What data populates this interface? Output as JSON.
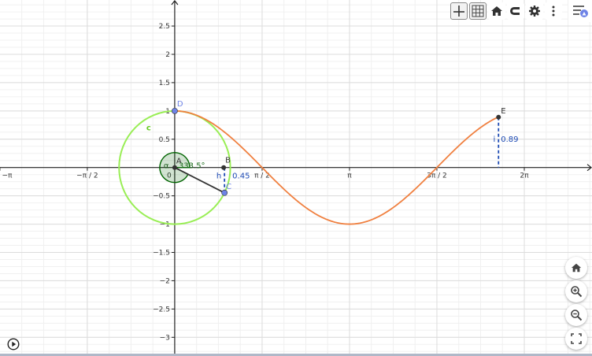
{
  "axes": {
    "x_ticks": [
      {
        "label": "−π",
        "value": -3.14159
      },
      {
        "label": "−π / 2",
        "value": -1.5708
      },
      {
        "label": "0",
        "value": 0
      },
      {
        "label": "π / 2",
        "value": 1.5708
      },
      {
        "label": "π",
        "value": 3.14159
      },
      {
        "label": "3π / 2",
        "value": 4.71239
      },
      {
        "label": "2π",
        "value": 6.28319
      }
    ],
    "y_ticks": [
      {
        "label": "2.5",
        "value": 2.5
      },
      {
        "label": "2",
        "value": 2
      },
      {
        "label": "1.5",
        "value": 1.5
      },
      {
        "label": "1",
        "value": 1
      },
      {
        "label": "0.5",
        "value": 0.5
      },
      {
        "label": "−0.5",
        "value": -0.5
      },
      {
        "label": "−1",
        "value": -1
      },
      {
        "label": "−1.5",
        "value": -1.5
      },
      {
        "label": "−2",
        "value": -2
      },
      {
        "label": "−2.5",
        "value": -2.5
      },
      {
        "label": "−3",
        "value": -3
      }
    ],
    "x_range": [
      -3.14,
      7.5
    ],
    "y_range": [
      -3.33,
      2.96
    ]
  },
  "objects": {
    "circle_label": "c",
    "point_a_label": "A",
    "point_b_label": "B",
    "point_c_label": "C",
    "point_d_label": "D",
    "point_e_label": "E",
    "angle_name": "α",
    "angle_value": "333.5°",
    "segment_h_label": "h",
    "segment_h_value": "0.45",
    "segment_i_label": "i",
    "segment_i_value": "0.89",
    "angle_deg": 333.5,
    "point_b": [
      0.88,
      0
    ],
    "point_e": [
      5.82,
      0.89
    ]
  },
  "colors": {
    "circle": "#99ee55",
    "curve": "#f08040",
    "point_blue": "#6e83e6",
    "segment_dashed": "#1d4ab4",
    "angle_fill": "#006400",
    "grid_major": "#dcdcdc",
    "grid_minor": "#f0f0f0"
  },
  "toolbar": {
    "axes_icon": "axes-icon",
    "grid_icon": "grid-icon",
    "home_icon": "home-icon",
    "snap_icon": "magnet-icon",
    "settings_icon": "gear-icon",
    "more_icon": "kebab-icon",
    "menu_icon": "menu-icon"
  },
  "zoom_controls": [
    "home-icon",
    "zoom-in-icon",
    "zoom-out-icon",
    "fullscreen-icon"
  ],
  "play_icon": "play-icon"
}
